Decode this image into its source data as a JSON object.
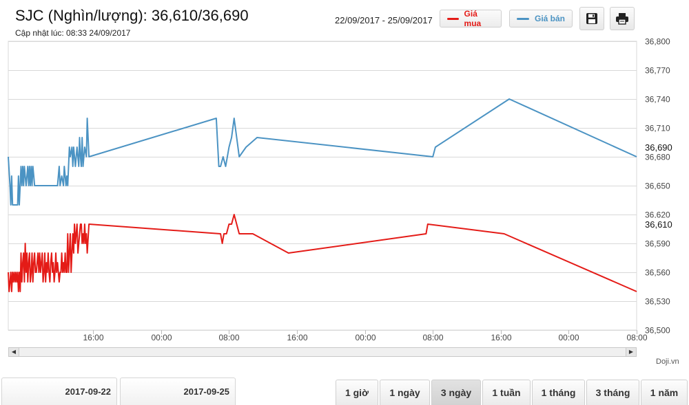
{
  "header": {
    "title": "SJC (Nghìn/lượng): 36,610/36,690",
    "updated": "Cập nhật lúc: 08:33 24/09/2017",
    "date_range": "22/09/2017 - 25/09/2017",
    "legend_buy": "Giá mua",
    "legend_sell": "Giá bán",
    "save_icon": "floppy-disk-icon",
    "print_icon": "printer-icon"
  },
  "colors": {
    "buy": "#e41b17",
    "sell": "#4b93c3",
    "grid": "#d8d8d8"
  },
  "chart_data": {
    "type": "line",
    "title": "SJC (Nghìn/lượng): 36,610/36,690",
    "xlabel": "",
    "ylabel": "",
    "x_tick_labels": [
      "16:00",
      "00:00",
      "08:00",
      "16:00",
      "00:00",
      "08:00",
      "16:00",
      "00:00",
      "08:00"
    ],
    "x_ticks_hours_from_start": [
      10,
      18,
      26,
      34,
      42,
      50,
      58,
      66,
      74
    ],
    "xlim_hours_from_start": [
      0,
      74
    ],
    "ylim": [
      36500,
      36800
    ],
    "y_ticks": [
      36500,
      36530,
      36560,
      36590,
      36620,
      36650,
      36680,
      36710,
      36740,
      36770,
      36800
    ],
    "y_tick_labels": [
      "36,500",
      "36,530",
      "36,560",
      "36,590",
      "36,620",
      "36,650",
      "36,680",
      "36,710",
      "36,740",
      "36,770",
      "36,800"
    ],
    "last_value_labels": [
      {
        "series": "Giá bán",
        "value": 36690,
        "label": "36,690"
      },
      {
        "series": "Giá mua",
        "value": 36610,
        "label": "36,610"
      }
    ],
    "grid": true,
    "legend": "top",
    "series": [
      {
        "name": "Giá bán",
        "color": "#4b93c3",
        "x": [
          0,
          0.2,
          0.3,
          0.4,
          0.5,
          0.7,
          0.9,
          1.1,
          1.2,
          1.3,
          1.5,
          1.6,
          1.7,
          1.8,
          1.9,
          2,
          2.1,
          2.3,
          2.4,
          2.5,
          2.6,
          2.7,
          2.8,
          2.9,
          3,
          3.1,
          3.2,
          3.3,
          3.4,
          3.5,
          3.6,
          3.7,
          3.9,
          4.1,
          4.3,
          4.5,
          4.7,
          5,
          5.3,
          5.5,
          5.8,
          6,
          6.1,
          6.3,
          6.5,
          6.6,
          6.8,
          6.9,
          7,
          7.2,
          7.3,
          7.5,
          7.6,
          7.7,
          7.9,
          8,
          8.1,
          8.3,
          8.4,
          8.5,
          8.6,
          8.7,
          8.8,
          8.9,
          9,
          9.2,
          9.3,
          9.5,
          24.5,
          24.8,
          25,
          25.3,
          25.6,
          26,
          26.3,
          26.6,
          27.2,
          28,
          29.3,
          50,
          50.3,
          59,
          74
        ],
        "y": [
          36680,
          36650,
          36630,
          36660,
          36630,
          36630,
          36630,
          36630,
          36660,
          36630,
          36670,
          36650,
          36670,
          36650,
          36670,
          36660,
          36650,
          36670,
          36650,
          36670,
          36650,
          36670,
          36650,
          36670,
          36660,
          36650,
          36650,
          36650,
          36650,
          36650,
          36650,
          36650,
          36650,
          36650,
          36650,
          36650,
          36650,
          36650,
          36650,
          36650,
          36650,
          36670,
          36650,
          36660,
          36650,
          36670,
          36650,
          36660,
          36650,
          36690,
          36680,
          36690,
          36670,
          36690,
          36670,
          36680,
          36690,
          36670,
          36700,
          36680,
          36670,
          36700,
          36670,
          36680,
          36690,
          36680,
          36720,
          36680,
          36720,
          36670,
          36670,
          36680,
          36670,
          36690,
          36700,
          36720,
          36680,
          36690,
          36700,
          36680,
          36690,
          36740,
          36680
        ]
      },
      {
        "name": "Giá mua",
        "color": "#e41b17",
        "x": [
          0,
          0.1,
          0.2,
          0.3,
          0.4,
          0.5,
          0.6,
          0.7,
          0.8,
          0.9,
          1,
          1.1,
          1.2,
          1.3,
          1.4,
          1.5,
          1.6,
          1.7,
          1.8,
          1.9,
          2,
          2.1,
          2.2,
          2.3,
          2.4,
          2.5,
          2.6,
          2.7,
          2.8,
          2.9,
          3,
          3.1,
          3.2,
          3.3,
          3.4,
          3.5,
          3.6,
          3.7,
          3.8,
          3.9,
          4,
          4.1,
          4.2,
          4.3,
          4.4,
          4.5,
          4.6,
          4.7,
          4.8,
          4.9,
          5,
          5.1,
          5.2,
          5.3,
          5.4,
          5.5,
          5.6,
          5.7,
          5.8,
          5.9,
          6,
          6.1,
          6.2,
          6.3,
          6.4,
          6.5,
          6.6,
          6.7,
          6.8,
          6.9,
          7,
          7.1,
          7.2,
          7.3,
          7.4,
          7.5,
          7.6,
          7.7,
          7.8,
          7.9,
          8,
          8.1,
          8.2,
          8.3,
          8.4,
          8.5,
          8.6,
          8.7,
          8.8,
          8.9,
          9,
          9.1,
          9.2,
          9.3,
          9.5,
          25,
          25.2,
          25.4,
          25.7,
          26,
          26.3,
          26.6,
          26.9,
          27.2,
          27.6,
          28.2,
          28.8,
          33,
          49.2,
          49.4,
          58.4,
          74
        ],
        "y": [
          36560,
          36540,
          36550,
          36560,
          36540,
          36560,
          36550,
          36560,
          36550,
          36560,
          36550,
          36560,
          36540,
          36560,
          36540,
          36580,
          36550,
          36570,
          36580,
          36550,
          36590,
          36560,
          36580,
          36550,
          36570,
          36580,
          36550,
          36560,
          36580,
          36550,
          36570,
          36580,
          36560,
          36560,
          36570,
          36580,
          36560,
          36580,
          36560,
          36570,
          36580,
          36550,
          36560,
          36580,
          36550,
          36570,
          36560,
          36580,
          36560,
          36550,
          36570,
          36580,
          36560,
          36570,
          36550,
          36560,
          36580,
          36560,
          36570,
          36560,
          36550,
          36560,
          36560,
          36580,
          36560,
          36570,
          36560,
          36580,
          36560,
          36560,
          36600,
          36560,
          36580,
          36600,
          36560,
          36580,
          36600,
          36580,
          36610,
          36590,
          36600,
          36610,
          36580,
          36590,
          36600,
          36610,
          36610,
          36590,
          36600,
          36590,
          36610,
          36590,
          36600,
          36580,
          36610,
          36600,
          36590,
          36600,
          36600,
          36610,
          36610,
          36620,
          36610,
          36600,
          36600,
          36600,
          36600,
          36580,
          36600,
          36610,
          36600,
          36540
        ]
      }
    ]
  },
  "scrollbar": {
    "left_arrow": "◀",
    "right_arrow": "▶"
  },
  "source": "Doji.vn",
  "dates": {
    "from": "2017-09-22",
    "to": "2017-09-25"
  },
  "periods": [
    "1 giờ",
    "1 ngày",
    "3 ngày",
    "1 tuần",
    "1 tháng",
    "3 tháng",
    "1 năm"
  ],
  "active_period": "3 ngày"
}
